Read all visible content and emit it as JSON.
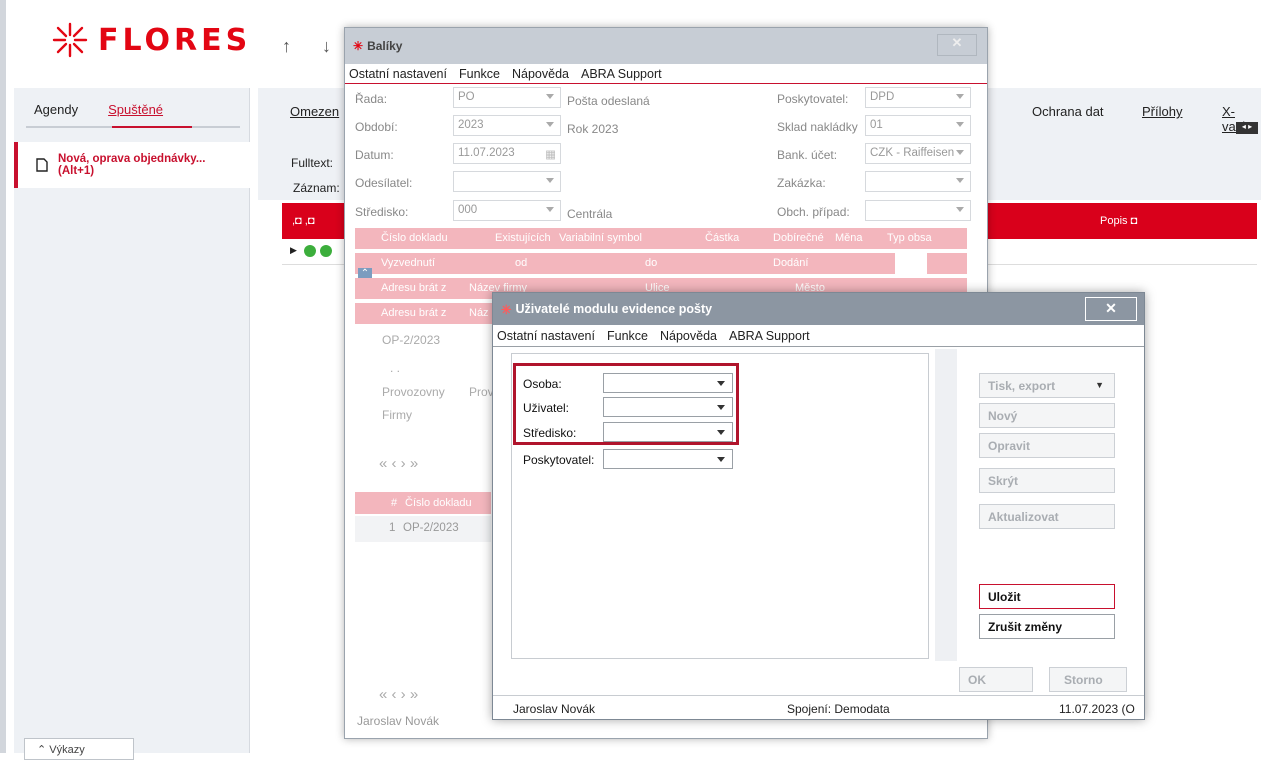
{
  "brand": {
    "logo_text": "FLORES",
    "color": "#e30613"
  },
  "nav": {
    "up": "↑",
    "down": "↓"
  },
  "left_panel": {
    "tabs": [
      "Agendy",
      "Spuštěné"
    ],
    "item": "Nová, oprava objednávky...\n(Alt+1)",
    "vykazy": "Výkazy"
  },
  "main": {
    "top_links": [
      "Omezen",
      "Ochrana dat",
      "Přílohy",
      "X-vazb"
    ],
    "fulltext_label": "Fulltext:",
    "zaznam_label": "Záznam:",
    "popis_header": "Popis ◘",
    "col_icons": ",◘ ,◘"
  },
  "baliky": {
    "title": "Balíky",
    "menu": [
      "Ostatní nastavení",
      "Funkce",
      "Nápověda",
      "ABRA Support"
    ],
    "left_fields": [
      {
        "label": "Řada:",
        "value": "PO",
        "desc": "Pošta odeslaná"
      },
      {
        "label": "Období:",
        "value": "2023",
        "desc": "Rok 2023"
      },
      {
        "label": "Datum:",
        "value": "11.07.2023",
        "desc": ""
      },
      {
        "label": "Odesílatel:",
        "value": "",
        "desc": ""
      },
      {
        "label": "Středisko:",
        "value": "000",
        "desc": "Centrála"
      }
    ],
    "right_fields": [
      {
        "label": "Poskytovatel:",
        "value": "DPD"
      },
      {
        "label": "Sklad nakládky",
        "value": "01"
      },
      {
        "label": "Bank. účet:",
        "value": "CZK - Raiffeisen"
      },
      {
        "label": "Zakázka:",
        "value": ""
      },
      {
        "label": "Obch. případ:",
        "value": ""
      }
    ],
    "grid_header": [
      "Číslo dokladu",
      "Existujících",
      "Variabilní symbol",
      "Částka",
      "Dobírečné",
      "Měna",
      "Typ obsa"
    ],
    "row2": [
      "Vyzvednutí",
      "od",
      "do",
      "Dodání"
    ],
    "row3": [
      "Adresu brát z",
      "Název firmy",
      "Ulice",
      "Město"
    ],
    "row4": [
      "Adresu brát z",
      "Náz"
    ],
    "record": "OP-2/2023",
    "dots": ". .",
    "prov": [
      "Provozovny",
      "Prov"
    ],
    "firmy": "Firmy",
    "pager": "«   ‹   ›   »",
    "sub_header": [
      "#",
      "Číslo dokladu"
    ],
    "sub_row": [
      "1",
      "OP-2/2023"
    ],
    "footer": "Jaroslav Novák"
  },
  "uzivatele": {
    "title": "Uživatelé modulu evidence pošty",
    "close": "✕",
    "menu": [
      "Ostatní nastavení",
      "Funkce",
      "Nápověda",
      "ABRA Support"
    ],
    "fields": [
      "Osoba:",
      "Uživatel:",
      "Středisko:",
      "Poskytovatel:"
    ],
    "buttons": [
      "Tisk, export",
      "Nový",
      "Opravit",
      "Skrýt",
      "Aktualizovat"
    ],
    "save": "Uložit",
    "cancel_changes": "Zrušit změny",
    "ok": "OK",
    "storno": "Storno",
    "status": {
      "user": "Jaroslav Novák",
      "connection": "Spojení: Demodata",
      "date": "11.07.2023 (O"
    }
  }
}
